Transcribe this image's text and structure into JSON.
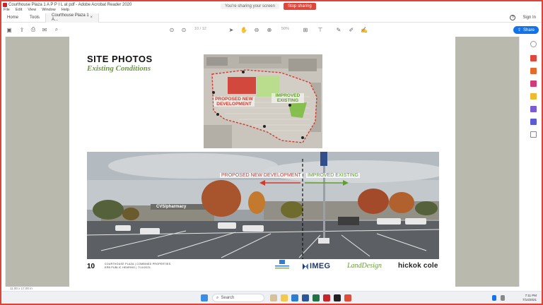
{
  "window": {
    "title": "Courthouse Plaza 1 A P P I L at pdf - Adobe Acrobat Reader 2020",
    "share_message": "You're sharing your screen",
    "stop_sharing_label": "Stop sharing"
  },
  "menu": [
    "File",
    "Edit",
    "View",
    "Window",
    "Help"
  ],
  "tabs": {
    "home": "Home",
    "tools": "Tools",
    "document": "Courthouse Plaza 1 A...",
    "sign_in": "Sign In"
  },
  "toolbar": {
    "page_indicator": "10 / 12",
    "zoom": "50%",
    "share_label": "Share"
  },
  "slide": {
    "title": "SITE PHOTOS",
    "subtitle": "Existing Conditions",
    "map_labels": {
      "proposed": "PROPOSED NEW DEVELOPMENT",
      "improved": "IMPROVED EXISTING"
    },
    "photo_labels": {
      "proposed": "PROPOSED NEW DEVELOPMENT",
      "improved": "IMPROVED EXISTING",
      "store_sign": "CVS/pharmacy"
    },
    "page_number": "10",
    "project_line1": "COURTHOUSE PLAZA  |  COMBINED PROPERTIES",
    "project_line2": "ERB PUBLIC HEARING  |  7/14/2021",
    "logos": {
      "combined": "Combined Properties",
      "imeg": "IMEG",
      "landdesign": "LandDesign",
      "hickok": "hickok cole"
    }
  },
  "statusbar": {
    "size": "11.00 x 17.00 in"
  },
  "taskbar": {
    "search_placeholder": "Search",
    "time": "7:11 PM",
    "date": "7/14/2021"
  },
  "colors": {
    "accent_red": "#d9453a",
    "acrobat_blue": "#1473e6",
    "subtitle_green": "#6a9b3b",
    "proposed_red": "#d33a2c",
    "improved_green": "#7dbe3f"
  }
}
